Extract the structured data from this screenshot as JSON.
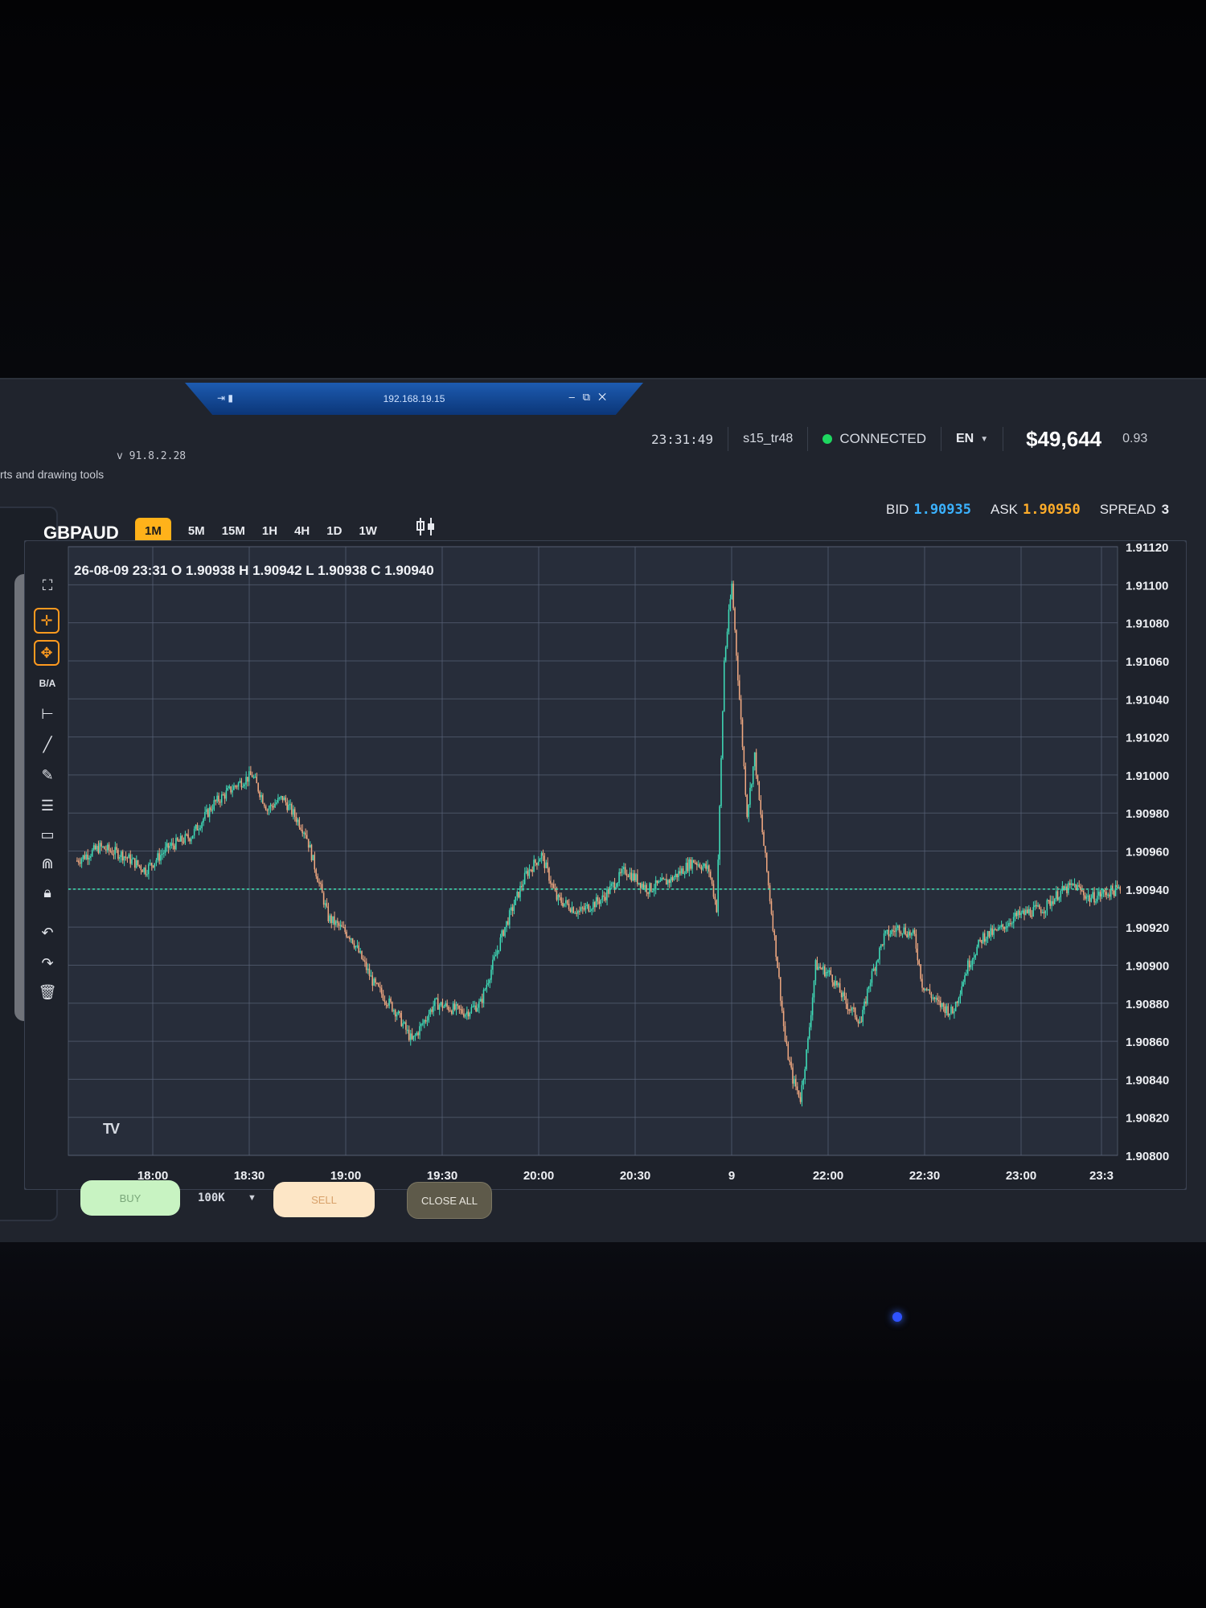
{
  "remote_window": {
    "title": "192.168.19.15"
  },
  "app": {
    "hint_text": "rts and drawing tools",
    "version": "v 91.8.2.28",
    "clock": "23:31:49",
    "user": "s15_tr48",
    "status": "CONNECTED",
    "language": "EN",
    "balance": "$49,644",
    "side_value": "0.93"
  },
  "symbol": "GBPAUD",
  "timeframes": [
    {
      "label": "1M",
      "active": true
    },
    {
      "label": "5M",
      "active": false
    },
    {
      "label": "15M",
      "active": false
    },
    {
      "label": "1H",
      "active": false
    },
    {
      "label": "4H",
      "active": false
    },
    {
      "label": "1D",
      "active": false
    },
    {
      "label": "1W",
      "active": false
    }
  ],
  "quote": {
    "bid_label": "BID",
    "bid": "1.90935",
    "ask_label": "ASK",
    "ask": "1.90950",
    "spread_label": "SPREAD",
    "spread": "3"
  },
  "ohlc_legend": "26-08-09 23:31 O 1.90938 H 1.90942 L 1.90938 C 1.90940",
  "tools": [
    {
      "name": "fullscreen-icon"
    },
    {
      "name": "crosshair-icon",
      "boxed": true
    },
    {
      "name": "move-icon",
      "boxed": true
    },
    {
      "name": "bid-ask-toggle",
      "label": "B/A"
    },
    {
      "name": "horizontal-ray-icon"
    },
    {
      "name": "trend-line-icon"
    },
    {
      "name": "pencil-icon"
    },
    {
      "name": "fib-levels-icon"
    },
    {
      "name": "rectangle-icon"
    },
    {
      "name": "magnet-icon"
    },
    {
      "name": "lock-icon"
    },
    {
      "name": "undo-icon"
    },
    {
      "name": "redo-icon"
    },
    {
      "name": "trash-icon"
    }
  ],
  "order_panel": {
    "buy_label": "BUY",
    "size": "100K",
    "sell_label": "SELL",
    "close_all_label": "CLOSE ALL"
  },
  "colors": {
    "up": "#3fdcb8",
    "down": "#f0a880",
    "accent": "#ffb21a",
    "bid": "#3bb2ff",
    "ask": "#ffad2a",
    "price_line": "#3fe0b0",
    "grid": "#5a6478",
    "plot_bg": "#272d3a"
  },
  "chart_data": {
    "type": "candlestick",
    "x_tick_labels": [
      "18:00",
      "18:30",
      "19:00",
      "19:30",
      "20:00",
      "20:30",
      "9",
      "22:00",
      "22:30",
      "23:00",
      "23:3"
    ],
    "y_tick_labels": [
      "1.91120",
      "1.91100",
      "1.91080",
      "1.91060",
      "1.91040",
      "1.91020",
      "1.91000",
      "1.90980",
      "1.90960",
      "1.90940",
      "1.90920",
      "1.90900",
      "1.90880",
      "1.90860",
      "1.90840",
      "1.90820",
      "1.90800"
    ],
    "ylim": [
      1.908,
      1.9112
    ],
    "current_price": 1.9094,
    "close_path": [
      [
        0,
        1.90955
      ],
      [
        15,
        1.90962
      ],
      [
        30,
        1.90958
      ],
      [
        45,
        1.9095
      ],
      [
        60,
        1.90962
      ],
      [
        75,
        1.90968
      ],
      [
        90,
        1.90985
      ],
      [
        105,
        1.90995
      ],
      [
        115,
        1.91
      ],
      [
        125,
        1.90982
      ],
      [
        135,
        1.90988
      ],
      [
        150,
        1.9097
      ],
      [
        165,
        1.90925
      ],
      [
        180,
        1.90915
      ],
      [
        195,
        1.9089
      ],
      [
        210,
        1.90875
      ],
      [
        220,
        1.9086
      ],
      [
        235,
        1.9088
      ],
      [
        255,
        1.90875
      ],
      [
        265,
        1.9088
      ],
      [
        280,
        1.90918
      ],
      [
        295,
        1.90948
      ],
      [
        305,
        1.90958
      ],
      [
        315,
        1.90935
      ],
      [
        330,
        1.90928
      ],
      [
        345,
        1.90935
      ],
      [
        360,
        1.9095
      ],
      [
        375,
        1.9094
      ],
      [
        390,
        1.90945
      ],
      [
        405,
        1.90955
      ],
      [
        415,
        1.9095
      ],
      [
        420,
        1.9093
      ],
      [
        425,
        1.9106
      ],
      [
        430,
        1.911
      ],
      [
        435,
        1.9104
      ],
      [
        440,
        1.9098
      ],
      [
        445,
        1.9101
      ],
      [
        450,
        1.9097
      ],
      [
        455,
        1.90935
      ],
      [
        460,
        1.909
      ],
      [
        465,
        1.9086
      ],
      [
        470,
        1.9084
      ],
      [
        475,
        1.9083
      ],
      [
        480,
        1.9086
      ],
      [
        485,
        1.909
      ],
      [
        495,
        1.90895
      ],
      [
        505,
        1.9088
      ],
      [
        515,
        1.9087
      ],
      [
        520,
        1.9089
      ],
      [
        530,
        1.90915
      ],
      [
        540,
        1.9092
      ],
      [
        550,
        1.90915
      ],
      [
        555,
        1.9089
      ],
      [
        565,
        1.9088
      ],
      [
        575,
        1.90875
      ],
      [
        585,
        1.909
      ],
      [
        595,
        1.90915
      ],
      [
        605,
        1.90918
      ],
      [
        615,
        1.90925
      ],
      [
        625,
        1.90928
      ],
      [
        635,
        1.9093
      ],
      [
        645,
        1.90938
      ],
      [
        655,
        1.90942
      ],
      [
        665,
        1.90935
      ],
      [
        675,
        1.90938
      ],
      [
        685,
        1.9094
      ]
    ]
  }
}
